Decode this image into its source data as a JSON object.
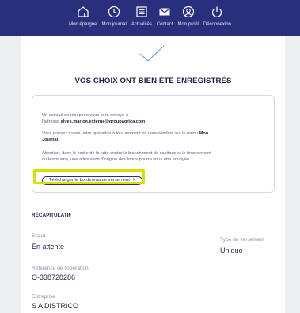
{
  "nav": {
    "items": [
      {
        "label": "Mon épargne",
        "icon": "home-icon"
      },
      {
        "label": "Mon journal",
        "icon": "clock-icon"
      },
      {
        "label": "Actualités",
        "icon": "news-icon"
      },
      {
        "label": "Contact",
        "icon": "envelope-icon"
      },
      {
        "label": "Mon profil",
        "icon": "user-icon"
      },
      {
        "label": "Déconnexion",
        "icon": "power-icon"
      }
    ]
  },
  "confirmation": {
    "title": "VOS CHOIX ONT BIEN ÉTÉ ENREGISTRÉS",
    "icon": "check-icon"
  },
  "info": {
    "line1": "Un accusé de réception vous sera envoyé à",
    "line2_prefix": "l'adresse ",
    "email": "alves.marion.externe@groupagrica.com",
    "line3_prefix": "Vous pouvez suivre votre opération à tout moment en vous rendant sur le menu ",
    "line3_bold": "Mon",
    "line4_bold": "Journal",
    "line4_suffix": ".",
    "line5": "Attention, dans le cadre de la lutte contre le blanchiment de capitaux et le financement",
    "line6": "du terrorisme, une attestation d'origine des fonds pourra vous être envoyée.",
    "download_label": "Télécharger le bordereau de versement",
    "download_chevron": ">"
  },
  "recap": {
    "title": "RÉCAPITULATIF",
    "statut_label": "Statut",
    "statut_value": "En attente",
    "type_label": "Type de versement",
    "type_value": "Unique",
    "ref_label": "Référence de l'opération",
    "ref_value": "O-338728286",
    "entreprise_label": "Entreprise",
    "entreprise_value": "S A DISTRICO"
  },
  "colors": {
    "nav_bg": "#2a2f7d",
    "accent": "#2a2f7d",
    "highlight": "#d8e000",
    "check": "#5b8fe0",
    "page_bg": "#eeeff3"
  }
}
